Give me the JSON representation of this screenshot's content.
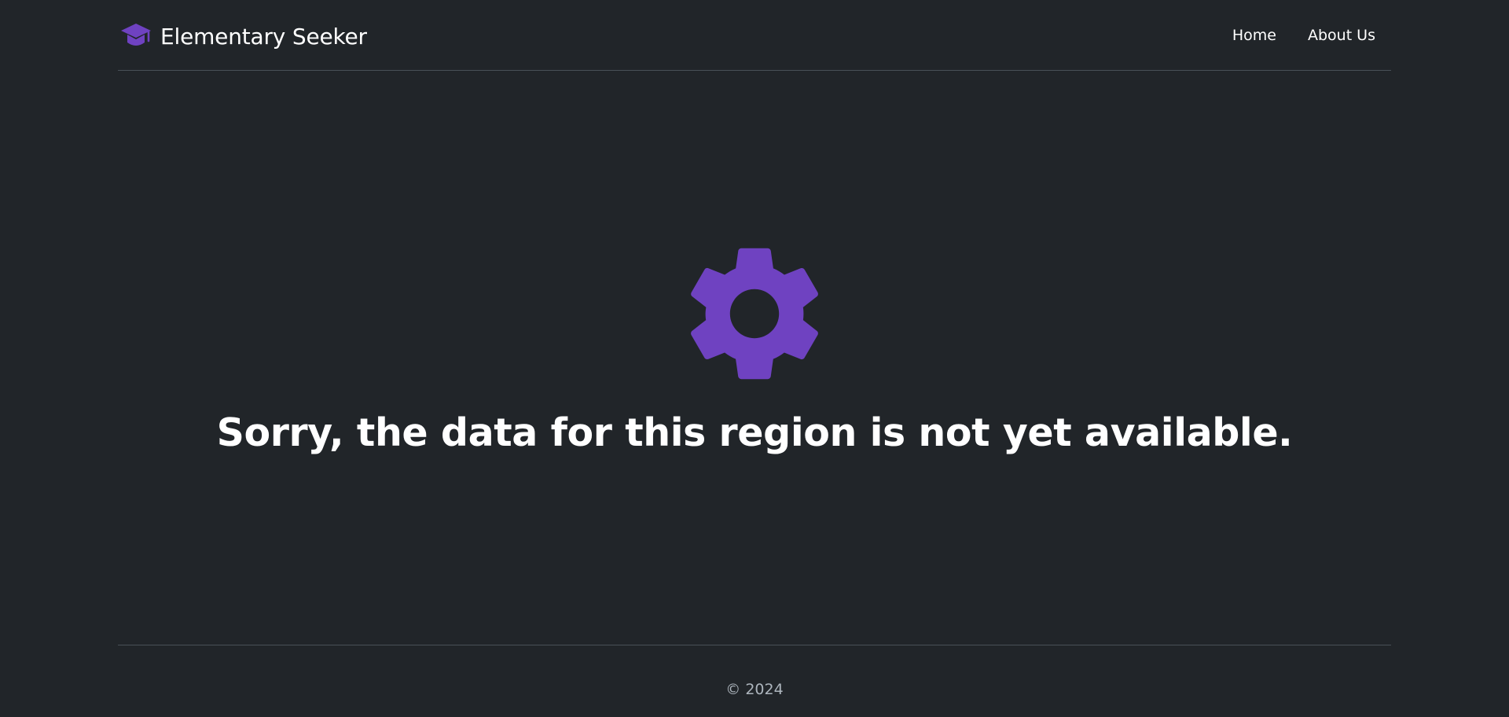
{
  "header": {
    "brand": {
      "icon": "graduation-cap-icon",
      "name": "Elementary Seeker"
    },
    "nav": {
      "items": [
        {
          "label": "Home"
        },
        {
          "label": "About Us"
        }
      ]
    }
  },
  "main": {
    "icon": "gear-icon",
    "message": "Sorry, the data for this region is not yet available."
  },
  "footer": {
    "copyright": "© 2024"
  },
  "colors": {
    "background": "#212529",
    "accent": "#6f42c1",
    "text": "#ffffff",
    "muted_text": "#adb5bd",
    "divider": "#495057"
  }
}
